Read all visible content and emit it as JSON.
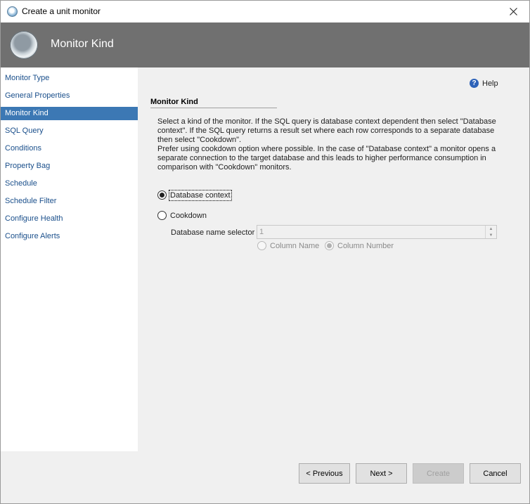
{
  "window": {
    "title": "Create a unit monitor",
    "close_icon": "close-icon"
  },
  "header": {
    "title": "Monitor Kind",
    "icon": "monitor-wizard-icon"
  },
  "sidebar": {
    "items": [
      {
        "label": "Monitor Type"
      },
      {
        "label": "General Properties"
      },
      {
        "label": "Monitor Kind",
        "active": true
      },
      {
        "label": "SQL Query"
      },
      {
        "label": "Conditions"
      },
      {
        "label": "Property Bag"
      },
      {
        "label": "Schedule"
      },
      {
        "label": "Schedule Filter"
      },
      {
        "label": "Configure Health"
      },
      {
        "label": "Configure Alerts"
      }
    ]
  },
  "content": {
    "help_label": "Help",
    "section_title": "Monitor Kind",
    "description_1": "Select a kind of the monitor. If the SQL query is database context dependent then select \"Database context\". If the SQL query returns a result set where each row corresponds to a separate database then select \"Cookdown\".",
    "description_2": "Prefer using cookdown option where possible. In the case of \"Database context\" a monitor opens a separate connection to the target database and this leads to higher performance consumption in comparison with \"Cookdown\" monitors.",
    "options": {
      "database_context": {
        "label": "Database context",
        "checked": true
      },
      "cookdown": {
        "label": "Cookdown",
        "checked": false
      }
    },
    "db_name_selector": {
      "label": "Database name selector",
      "value": "1",
      "enabled": false
    },
    "selector_mode": {
      "column_name": {
        "label": "Column Name",
        "checked": false
      },
      "column_number": {
        "label": "Column Number",
        "checked": true
      }
    }
  },
  "footer": {
    "previous_label": "< Previous",
    "next_label": "Next >",
    "create_label": "Create",
    "cancel_label": "Cancel"
  },
  "colors": {
    "header_bg": "#707070",
    "sidebar_active": "#3c78b4",
    "link_text": "#1a4f8b"
  }
}
